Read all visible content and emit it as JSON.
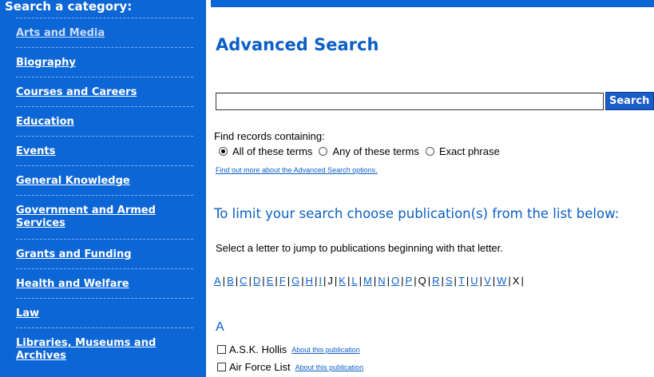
{
  "sidebar": {
    "heading": "Search a category:",
    "items": [
      {
        "label": "Arts and Media"
      },
      {
        "label": "Biography"
      },
      {
        "label": "Courses and Careers"
      },
      {
        "label": "Education"
      },
      {
        "label": "Events"
      },
      {
        "label": "General Knowledge"
      },
      {
        "label": "Government and Armed Services"
      },
      {
        "label": "Grants and Funding"
      },
      {
        "label": "Health and Welfare"
      },
      {
        "label": "Law"
      },
      {
        "label": "Libraries, Museums and Archives"
      }
    ]
  },
  "main": {
    "title": "Advanced Search",
    "search": {
      "value": "",
      "button_label": "Search"
    },
    "find_label": "Find records containing:",
    "options": [
      {
        "label": "All of these terms",
        "checked": true
      },
      {
        "label": "Any of these terms",
        "checked": false
      },
      {
        "label": "Exact phrase",
        "checked": false
      }
    ],
    "more_link": "Find out more about the Advanced Search options.",
    "limit_heading": "To limit your search choose publication(s) from the list below:",
    "letter_hint": "Select a letter to jump to publications beginning with that letter.",
    "alphabet": [
      {
        "letter": "A",
        "link": true
      },
      {
        "letter": "B",
        "link": true
      },
      {
        "letter": "C",
        "link": true
      },
      {
        "letter": "D",
        "link": true
      },
      {
        "letter": "E",
        "link": true
      },
      {
        "letter": "F",
        "link": true
      },
      {
        "letter": "G",
        "link": true
      },
      {
        "letter": "H",
        "link": true
      },
      {
        "letter": "I",
        "link": true
      },
      {
        "letter": "J",
        "link": false
      },
      {
        "letter": "K",
        "link": true
      },
      {
        "letter": "L",
        "link": true
      },
      {
        "letter": "M",
        "link": true
      },
      {
        "letter": "N",
        "link": true
      },
      {
        "letter": "O",
        "link": true
      },
      {
        "letter": "P",
        "link": true
      },
      {
        "letter": "Q",
        "link": false
      },
      {
        "letter": "R",
        "link": true
      },
      {
        "letter": "S",
        "link": true
      },
      {
        "letter": "T",
        "link": true
      },
      {
        "letter": "U",
        "link": true
      },
      {
        "letter": "V",
        "link": true
      },
      {
        "letter": "W",
        "link": true
      },
      {
        "letter": "X",
        "link": false
      }
    ],
    "group_letter": "A",
    "publications": [
      {
        "name": "A.S.K. Hollis",
        "about": "About this publication"
      },
      {
        "name": "Air Force List",
        "about": "About this publication"
      }
    ]
  }
}
